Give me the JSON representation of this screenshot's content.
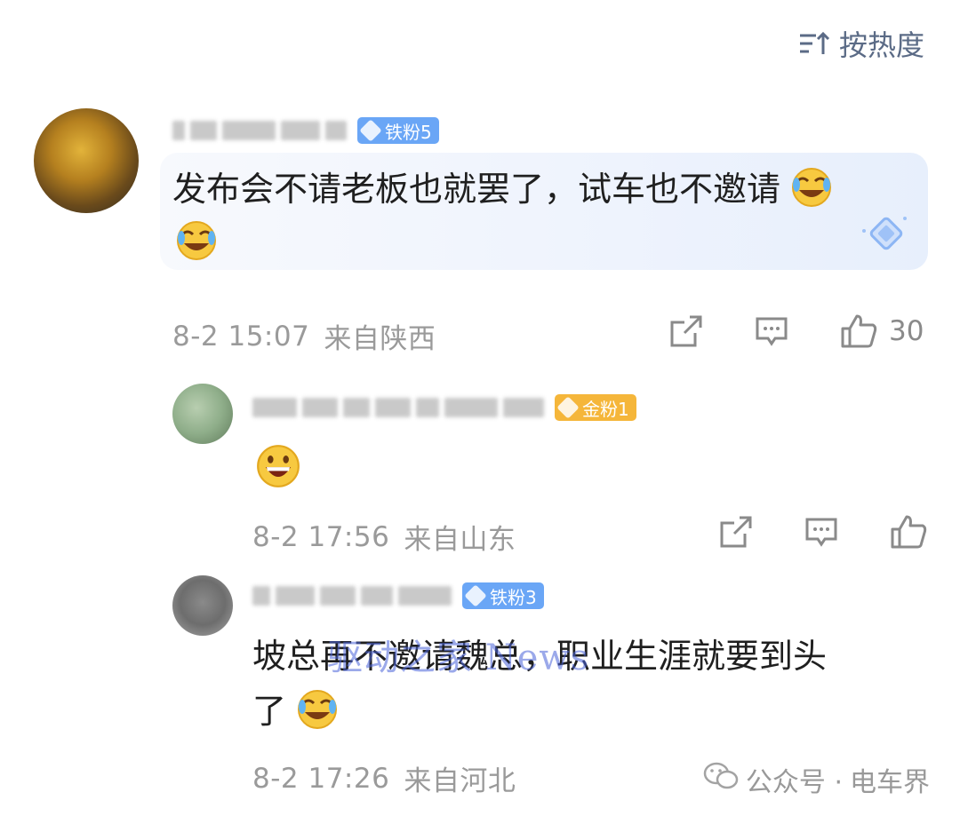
{
  "sort": {
    "label": "按热度",
    "icon": "sort-icon"
  },
  "comments": [
    {
      "badge": "铁粉5",
      "content": "发布会不请老板也就罢了，试车也不邀请",
      "timestamp": "8-2 15:07",
      "location": "来自陕西",
      "likes": "30"
    },
    {
      "badge": "金粉1",
      "content": "",
      "timestamp": "8-2 17:56",
      "location": "来自山东",
      "likes": ""
    },
    {
      "badge": "铁粉3",
      "content": "坡总再不邀请魏总，职业生涯就要到头了",
      "content_line1": "坡总再不邀请魏总，职业生涯就要到头",
      "content_line2": "了",
      "timestamp": "8-2 17:26",
      "location": "来自河北",
      "likes": ""
    }
  ],
  "watermark": "驱动之家 News",
  "account": {
    "prefix": "公众号 ·",
    "name": "电车界"
  },
  "colors": {
    "badge_iron": "#6aa6f6",
    "badge_gold": "#f5b63a",
    "meta": "#9a9a9a",
    "sort": "#5b6b86"
  }
}
